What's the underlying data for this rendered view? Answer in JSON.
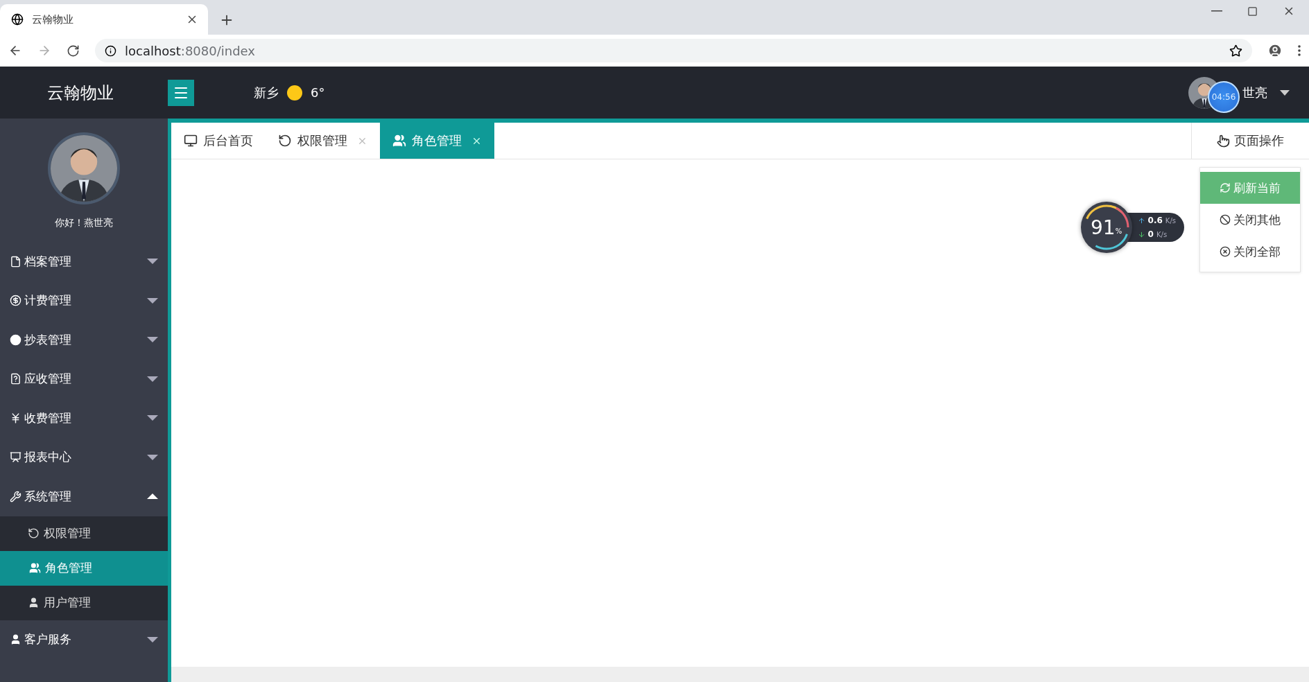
{
  "browser": {
    "tab_title": "云翰物业",
    "url_host": "localhost",
    "url_path": ":8080/index"
  },
  "header": {
    "logo": "云翰物业",
    "weather": {
      "city": "新乡",
      "temp": "6°"
    },
    "user": {
      "name": "世亮"
    },
    "timer": "04:56"
  },
  "tabs": [
    {
      "label": "后台首页",
      "kind": "monitor",
      "closable": false,
      "selected": false
    },
    {
      "label": "权限管理",
      "kind": "permission",
      "closable": true,
      "selected": false
    },
    {
      "label": "角色管理",
      "kind": "users",
      "closable": true,
      "selected": true
    }
  ],
  "page_actions": {
    "label": "页面操作",
    "menu": [
      {
        "label": "刷新当前",
        "kind": "refresh",
        "selected": true
      },
      {
        "label": "关闭其他",
        "kind": "ban",
        "selected": false
      },
      {
        "label": "关闭全部",
        "kind": "close",
        "selected": false
      }
    ]
  },
  "sidebar": {
    "greeting": "你好！燕世亮",
    "menu": [
      {
        "label": "档案管理",
        "kind": "file",
        "expanded": false
      },
      {
        "label": "计费管理",
        "kind": "dollar",
        "expanded": false
      },
      {
        "label": "抄表管理",
        "kind": "dot",
        "expanded": false
      },
      {
        "label": "应收管理",
        "kind": "question",
        "expanded": false
      },
      {
        "label": "收费管理",
        "kind": "yen",
        "expanded": false
      },
      {
        "label": "报表中心",
        "kind": "board",
        "expanded": false
      },
      {
        "label": "系统管理",
        "kind": "tools",
        "expanded": true,
        "children": [
          {
            "label": "权限管理",
            "kind": "permission",
            "selected": false
          },
          {
            "label": "角色管理",
            "kind": "users",
            "selected": true
          },
          {
            "label": "用户管理",
            "kind": "user",
            "selected": false
          }
        ]
      },
      {
        "label": "客户服务",
        "kind": "user",
        "expanded": false
      }
    ]
  },
  "net_widget": {
    "percent": "91",
    "percent_unit": "%",
    "up": {
      "value": "0.6",
      "unit": "K/s"
    },
    "down": {
      "value": "0",
      "unit": "K/s"
    }
  }
}
